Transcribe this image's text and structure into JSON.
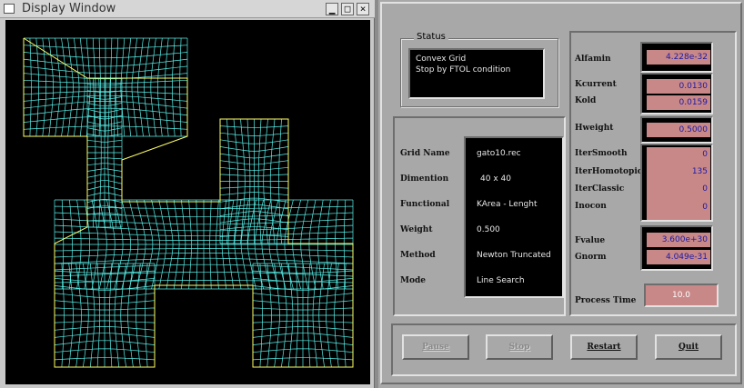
{
  "display_window": {
    "title": "Display Window",
    "minimize_glyph": "▁",
    "maximize_glyph": "□",
    "close_glyph": "×",
    "grid_color": "#59f0e9",
    "boundary_color": "#ffff66",
    "boundary_color_alt": "#2d2dff",
    "background": "#000000"
  },
  "status": {
    "legend": "Status",
    "lines": [
      "Convex Grid",
      "Stop by FTOL condition"
    ]
  },
  "params": [
    {
      "label": "Grid Name",
      "value": "gato10.rec"
    },
    {
      "label": "Dimention",
      "value": "40 x 40"
    },
    {
      "label": "Functional",
      "value": "KArea - Lenght"
    },
    {
      "label": "Weight",
      "value": "0.500"
    },
    {
      "label": "Method",
      "value": "Newton Truncated"
    },
    {
      "label": "Mode",
      "value": "Line Search"
    }
  ],
  "metrics": {
    "alfamin": {
      "label": "Alfamin",
      "value": "4.228e-32"
    },
    "kcurrent": {
      "label": "Kcurrent",
      "value": "0.0130"
    },
    "kold": {
      "label": "Kold",
      "value": "0.0159"
    },
    "hweight": {
      "label": "Hweight",
      "value": "0.5000"
    },
    "itersmooth": {
      "label": "IterSmooth",
      "value": "0"
    },
    "iterhomotopic": {
      "label": "IterHomotopic",
      "value": "135"
    },
    "iterclassic": {
      "label": "IterClassic",
      "value": "0"
    },
    "inocon": {
      "label": "Inocon",
      "value": "0"
    },
    "fvalue": {
      "label": "Fvalue",
      "value": "3.600e+30"
    },
    "gnorm": {
      "label": "Gnorm",
      "value": "4.049e-31"
    },
    "process_time": {
      "label": "Process Time",
      "value": "10.0"
    }
  },
  "buttons": {
    "pause": "Pause",
    "stop": "Stop",
    "restart": "Restart",
    "quit": "Quit"
  },
  "colors": {
    "panel_bg": "#a8a8a8",
    "value_bg": "#c98888",
    "value_text": "#1a1aa6"
  }
}
